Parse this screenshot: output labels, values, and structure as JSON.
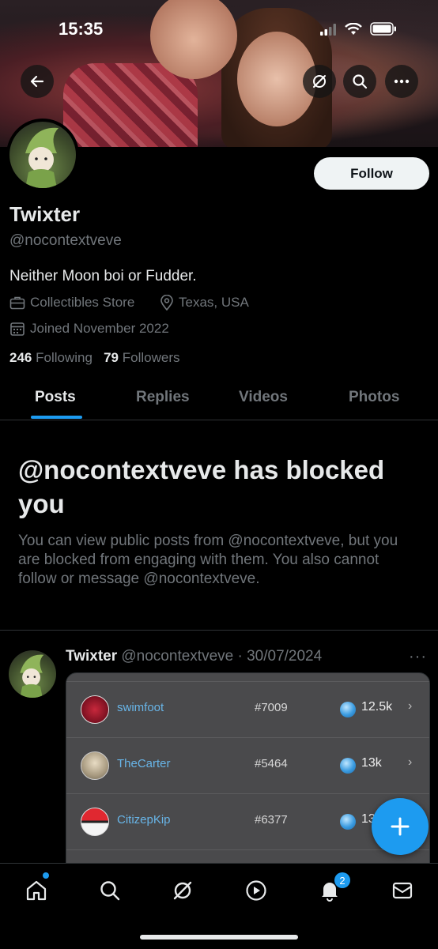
{
  "status_bar": {
    "time": "15:35"
  },
  "profile": {
    "name": "Twixter",
    "handle": "@nocontextveve",
    "bio": "Neither Moon boi or Fudder.",
    "category": "Collectibles Store",
    "location": "Texas, USA",
    "joined": "Joined November 2022",
    "following_count": "246",
    "following_label": "Following",
    "followers_count": "79",
    "followers_label": "Followers",
    "follow_label": "Follow"
  },
  "tabs": [
    {
      "label": "Posts",
      "active": true
    },
    {
      "label": "Replies",
      "active": false
    },
    {
      "label": "Videos",
      "active": false
    },
    {
      "label": "Photos",
      "active": false
    }
  ],
  "blocked": {
    "title": "@nocontextveve has blocked you",
    "text": "You can view public posts from @nocontextveve, but you are blocked from engaging with them. You also cannot follow or message @nocontextveve."
  },
  "post": {
    "author": "Twixter",
    "meta": "@nocontextveve · 30/07/2024",
    "more": "···",
    "rows": [
      {
        "user": "swimfoot",
        "rank": "#7009",
        "amount": "12.5k",
        "chevron": "›"
      },
      {
        "user": "TheCarter",
        "rank": "#5464",
        "amount": "13k",
        "chevron": "›"
      },
      {
        "user": "CitizepKip",
        "rank": "#6377",
        "amount": "13",
        "chevron": ""
      }
    ]
  },
  "bottom_nav": {
    "notifications_badge": "2",
    "items": [
      "home-icon",
      "search-icon",
      "grok-icon",
      "video-icon",
      "bell-icon",
      "mail-icon"
    ]
  },
  "colors": {
    "accent": "#1d9bf0",
    "background": "#000000",
    "muted": "#71767b",
    "text": "#e7e9ea"
  }
}
